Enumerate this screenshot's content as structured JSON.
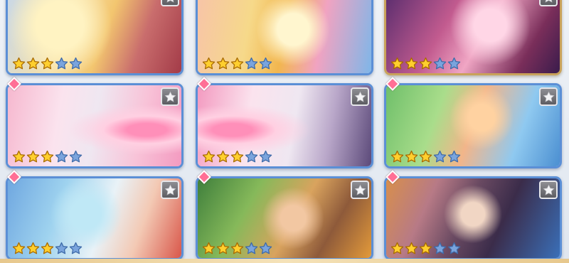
{
  "rarity_marker_color": "#ff6f95",
  "border_color": "#5b8fd6",
  "gold_border_color": "#c9a25a",
  "cards": [
    {
      "stars": 3,
      "max_stars": 5,
      "has_rank_icon": true,
      "has_diamond": false,
      "gold": false
    },
    {
      "stars": 3,
      "max_stars": 5,
      "has_rank_icon": false,
      "has_diamond": false,
      "gold": false
    },
    {
      "stars": 3,
      "max_stars": 5,
      "has_rank_icon": true,
      "has_diamond": false,
      "gold": true
    },
    {
      "stars": 3,
      "max_stars": 5,
      "has_rank_icon": true,
      "has_diamond": true,
      "gold": false
    },
    {
      "stars": 3,
      "max_stars": 5,
      "has_rank_icon": true,
      "has_diamond": true,
      "gold": false
    },
    {
      "stars": 3,
      "max_stars": 5,
      "has_rank_icon": true,
      "has_diamond": true,
      "gold": false
    },
    {
      "stars": 3,
      "max_stars": 5,
      "has_rank_icon": true,
      "has_diamond": true,
      "gold": false
    },
    {
      "stars": 3,
      "max_stars": 5,
      "has_rank_icon": true,
      "has_diamond": true,
      "gold": false
    },
    {
      "stars": 3,
      "max_stars": 5,
      "has_rank_icon": true,
      "has_diamond": true,
      "gold": false
    }
  ],
  "icons": {
    "rank": "star-badge-icon",
    "star": "star-icon",
    "marker": "diamond-icon"
  }
}
